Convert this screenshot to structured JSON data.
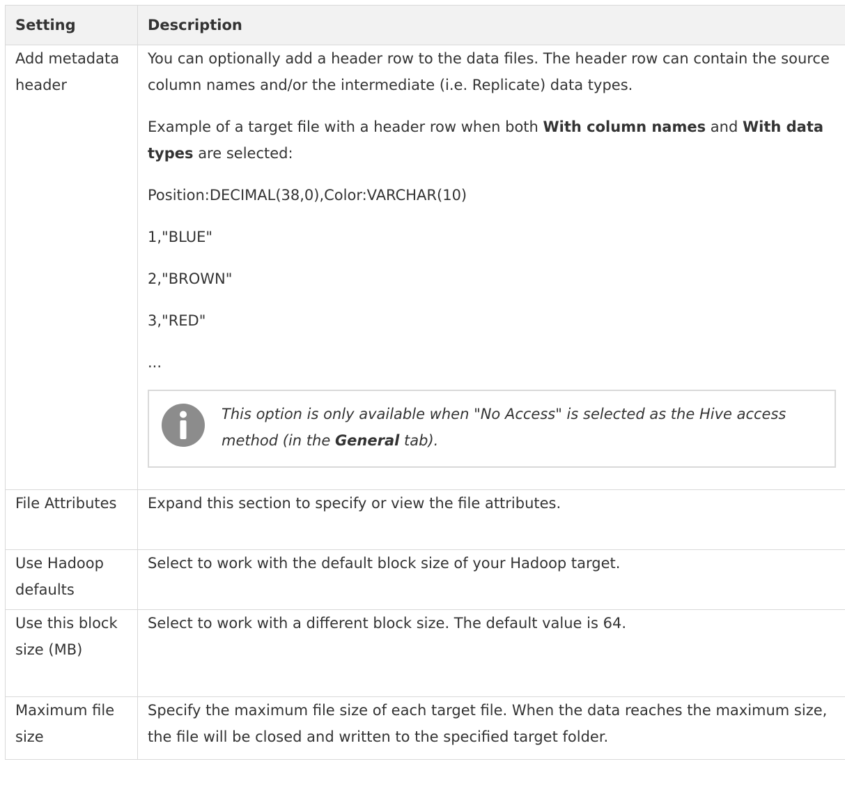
{
  "table": {
    "headers": [
      "Setting",
      "Description"
    ],
    "rows": [
      {
        "setting": "Add metadata header",
        "description_p1": "You can optionally add a header row to the data files. The header row can contain the source column names and/or the intermediate (i.e. Replicate) data types.",
        "description_p2_pre": "Example of a target file with a header row when both ",
        "description_p2_b1": "With column names",
        "description_p2_mid": " and ",
        "description_p2_b2": "With data types",
        "description_p2_post": " are selected:",
        "example_lines": [
          "Position:DECIMAL(38,0),Color:VARCHAR(10)",
          "1,\"BLUE\"",
          "2,\"BROWN\"",
          "3,\"RED\"",
          "..."
        ],
        "note": {
          "icon": "info-icon",
          "text_pre": "This option is only available when \"No Access\" is selected as the Hive access method (in the ",
          "text_bold": "General",
          "text_post": " tab)."
        }
      },
      {
        "setting": "File Attributes",
        "description": "Expand this section to specify or view the file attributes."
      },
      {
        "setting": "Use Hadoop defaults",
        "description": "Select to work with the default block size of your Hadoop target."
      },
      {
        "setting": "Use this block size (MB)",
        "description": "Select to work with a different block size. The default value is 64."
      },
      {
        "setting": "Maximum file size",
        "description": "Specify the maximum file size of each target file. When the data reaches the maximum size, the file will be closed and written to the specified target folder."
      }
    ]
  },
  "colors": {
    "header_bg": "#f2f2f2",
    "border": "#d9d9d9",
    "text": "#333333",
    "icon_bg": "#8c8c8c"
  }
}
